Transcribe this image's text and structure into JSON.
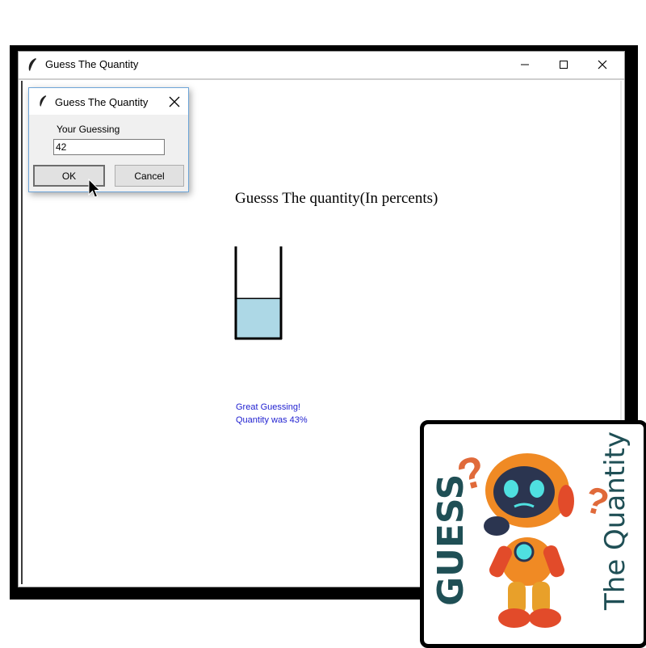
{
  "window": {
    "title": "Guess The Quantity",
    "minimize_icon": "minimize-icon",
    "maximize_icon": "maximize-icon",
    "close_icon": "close-icon"
  },
  "main": {
    "heading": "Guesss The quantity(In percents)",
    "glass": {
      "fill_level_percent": 43,
      "water_color": "#add8e6"
    },
    "result_line1": "Great Guessing!",
    "result_line2": "Quantity was 43%",
    "result_color": "#1f1fd0"
  },
  "dialog": {
    "title": "Guess The Quantity",
    "label": "Your Guessing",
    "input_value": "42",
    "ok_label": "OK",
    "cancel_label": "Cancel"
  },
  "logo": {
    "word1": "GUESS",
    "word2": "The Quantity",
    "accent_color": "#1f4f55",
    "robot_color": "#f08a24"
  }
}
